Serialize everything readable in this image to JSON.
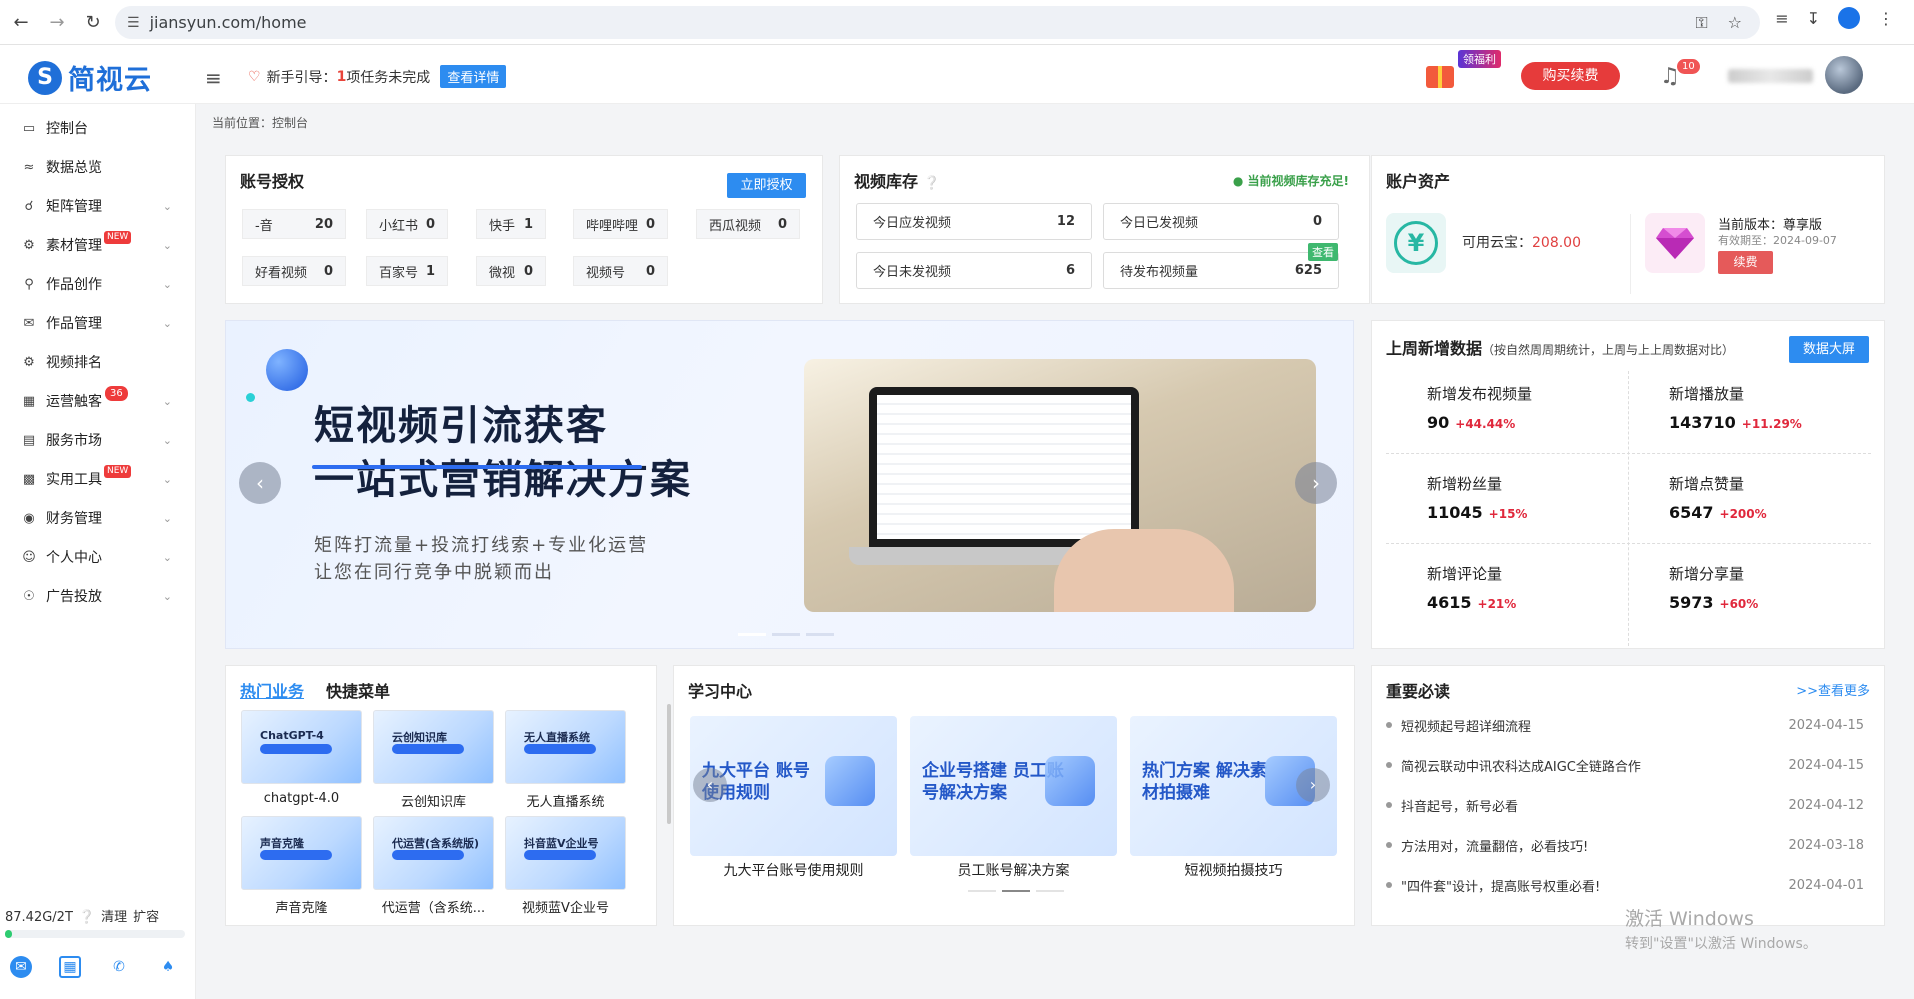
{
  "browser": {
    "url": "jiansyun.com/home"
  },
  "header": {
    "logo_text": "简视云",
    "guide_label": "新手引导：",
    "guide_count": "1",
    "guide_suffix": "项任务未完成",
    "guide_button": "查看详情",
    "gift_badge": "领福利",
    "buy_button": "购买续费",
    "notification_count": "10"
  },
  "sidebar": {
    "items": [
      {
        "label": "控制台",
        "icon": "desktop-icon"
      },
      {
        "label": "数据总览",
        "icon": "chart-icon"
      },
      {
        "label": "矩阵管理",
        "icon": "user-matrix-icon"
      },
      {
        "label": "素材管理",
        "icon": "gear-icon",
        "tag": "NEW"
      },
      {
        "label": "作品创作",
        "icon": "search-icon"
      },
      {
        "label": "作品管理",
        "icon": "chat-icon"
      },
      {
        "label": "视频排名",
        "icon": "gear-icon"
      },
      {
        "label": "运营触客",
        "icon": "building-icon",
        "badge": "36"
      },
      {
        "label": "服务市场",
        "icon": "store-icon"
      },
      {
        "label": "实用工具",
        "icon": "bar-chart-icon",
        "tag": "NEW"
      },
      {
        "label": "财务管理",
        "icon": "finance-icon"
      },
      {
        "label": "个人中心",
        "icon": "person-icon"
      },
      {
        "label": "广告投放",
        "icon": "ad-icon"
      }
    ],
    "storage_text": "87.42G/2T",
    "storage_clean": "清理",
    "storage_expand": "扩容",
    "storage_used": 0.04
  },
  "breadcrumb": "当前位置：控制台",
  "account_auth": {
    "title": "账号授权",
    "button": "立即授权",
    "items": [
      {
        "name": "-音",
        "count": "20"
      },
      {
        "name": "小红书",
        "count": "0"
      },
      {
        "name": "快手",
        "count": "1"
      },
      {
        "name": "哔哩哔哩",
        "count": "0"
      },
      {
        "name": "西瓜视频",
        "count": "0"
      },
      {
        "name": "好看视频",
        "count": "0"
      },
      {
        "name": "百家号",
        "count": "1"
      },
      {
        "name": "微视",
        "count": "0"
      },
      {
        "name": "视频号",
        "count": "0"
      }
    ]
  },
  "video_stock": {
    "title": "视频库存",
    "note": "当前视频库存充足!",
    "view_tag": "查看",
    "items": [
      {
        "label": "今日应发视频",
        "value": "12"
      },
      {
        "label": "今日已发视频",
        "value": "0"
      },
      {
        "label": "今日未发视频",
        "value": "6"
      },
      {
        "label": "待发布视频量",
        "value": "625"
      }
    ]
  },
  "assets": {
    "title": "账户资产",
    "cloud_label": "可用云宝：",
    "cloud_value": "208.00",
    "version_label": "当前版本：尊享版",
    "expiry": "有效期至：2024-09-07",
    "renew": "续费"
  },
  "banner": {
    "line1": "短视频引流获客",
    "line2": "一站式营销解决方案",
    "sub1": "矩阵打流量+投流打线索+专业化运营",
    "sub2": "让您在同行竞争中脱颖而出"
  },
  "weekly": {
    "title": "上周新增数据",
    "note": "（按自然周周期统计，上周与上上周数据对比）",
    "button": "数据大屏",
    "stats": [
      {
        "label": "新增发布视频量",
        "value": "90",
        "change": "+44.44%"
      },
      {
        "label": "新增播放量",
        "value": "143710",
        "change": "+11.29%"
      },
      {
        "label": "新增粉丝量",
        "value": "11045",
        "change": "+15%"
      },
      {
        "label": "新增点赞量",
        "value": "6547",
        "change": "+200%"
      },
      {
        "label": "新增评论量",
        "value": "4615",
        "change": "+21%"
      },
      {
        "label": "新增分享量",
        "value": "5973",
        "change": "+60%"
      }
    ]
  },
  "hot": {
    "tab_active": "热门业务",
    "tab_other": "快捷菜单",
    "tiles": [
      {
        "title": "ChatGPT-4",
        "caption": "chatgpt-4.0"
      },
      {
        "title": "云创知识库",
        "caption": "云创知识库"
      },
      {
        "title": "无人直播系统",
        "caption": "无人直播系统"
      },
      {
        "title": "声音克隆",
        "caption": "声音克隆"
      },
      {
        "title": "代运营(含系统版)",
        "caption": "代运营（含系统..."
      },
      {
        "title": "抖音蓝V企业号",
        "caption": "视频蓝V企业号"
      }
    ]
  },
  "learning": {
    "title": "学习中心",
    "tiles": [
      {
        "title": "九大平台 账号使用规则",
        "caption": "九大平台账号使用规则"
      },
      {
        "title": "企业号搭建 员工账号解决方案",
        "caption": "员工账号解决方案"
      },
      {
        "title": "热门方案 解决素材拍摄难",
        "caption": "短视频拍摄技巧"
      }
    ]
  },
  "notices": {
    "title": "重要必读",
    "more": ">>查看更多",
    "items": [
      {
        "text": "短视频起号超详细流程",
        "date": "2024-04-15"
      },
      {
        "text": "简视云联动中讯农科达成AIGC全链路合作",
        "date": "2024-04-15"
      },
      {
        "text": "抖音起号，新号必看",
        "date": "2024-04-12"
      },
      {
        "text": "方法用对，流量翻倍，必看技巧!",
        "date": "2024-03-18"
      },
      {
        "text": "\"四件套\"设计，提高账号权重必看!",
        "date": "2024-04-01"
      }
    ]
  },
  "watermark": {
    "line1": "激活 Windows",
    "line2": "转到\"设置\"以激活 Windows。"
  }
}
